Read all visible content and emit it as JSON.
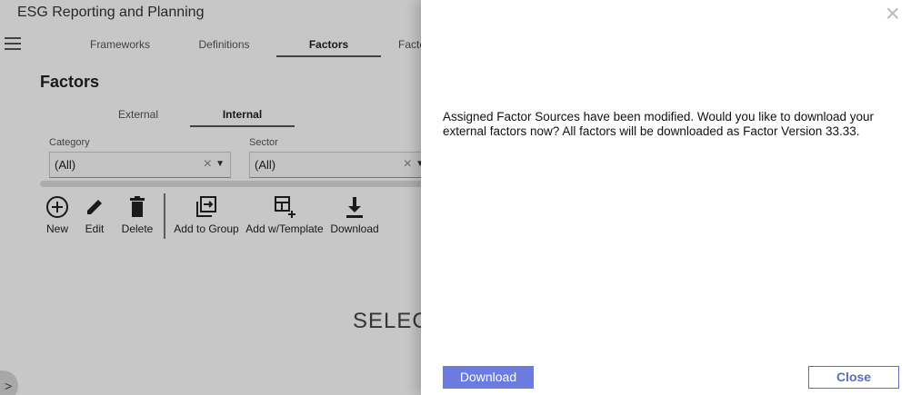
{
  "app": {
    "title": "ESG Reporting and Planning",
    "main_tabs": [
      {
        "label": "Frameworks",
        "active": false
      },
      {
        "label": "Definitions",
        "active": false
      },
      {
        "label": "Factors",
        "active": true
      },
      {
        "label": "Facto",
        "active": false
      }
    ],
    "section_title": "Factors",
    "sub_tabs": [
      {
        "label": "External",
        "active": false
      },
      {
        "label": "Internal",
        "active": true
      }
    ],
    "filters": [
      {
        "label": "Category",
        "value": "(All)"
      },
      {
        "label": "Sector",
        "value": "(All)"
      }
    ],
    "toolbar": [
      {
        "label": "New",
        "icon": "plus-circle-icon"
      },
      {
        "label": "Edit",
        "icon": "pencil-icon"
      },
      {
        "label": "Delete",
        "icon": "trash-icon"
      },
      {
        "label": "Add to Group",
        "icon": "add-to-group-icon"
      },
      {
        "label": "Add w/Template",
        "icon": "add-template-icon"
      },
      {
        "label": "Download",
        "icon": "download-icon"
      }
    ],
    "placeholder_text": "SELEC"
  },
  "dialog": {
    "message": "Assigned Factor Sources have been modified. Would you like to download your external factors now? All factors will be downloaded as Factor Version 33.33.",
    "download_label": "Download",
    "close_label": "Close",
    "close_icon": "×"
  },
  "colors": {
    "primary": "#6b7be0",
    "outline": "#5b6dc8",
    "overlay": "rgba(0,0,0,0.22)"
  }
}
